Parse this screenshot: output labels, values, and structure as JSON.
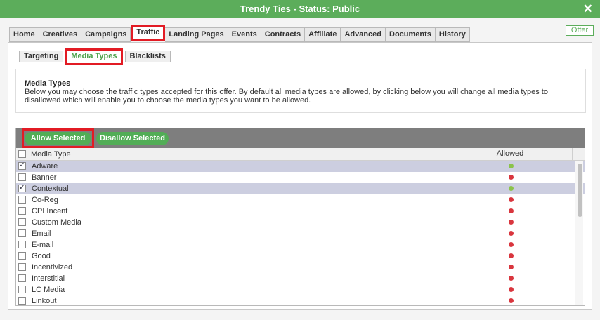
{
  "window": {
    "title": "Trendy Ties - Status: Public",
    "close_symbol": "✕",
    "title_bar_color": "#5cad5b"
  },
  "tabs": [
    {
      "label": "Home"
    },
    {
      "label": "Creatives"
    },
    {
      "label": "Campaigns"
    },
    {
      "label": "Traffic",
      "active": true
    },
    {
      "label": "Landing Pages"
    },
    {
      "label": "Events"
    },
    {
      "label": "Contracts"
    },
    {
      "label": "Affiliate"
    },
    {
      "label": "Advanced"
    },
    {
      "label": "Documents"
    },
    {
      "label": "History"
    }
  ],
  "badge": {
    "label": "Offer"
  },
  "subtabs": [
    {
      "label": "Targeting"
    },
    {
      "label": "Media Types",
      "active": true
    },
    {
      "label": "Blacklists"
    }
  ],
  "info": {
    "heading": "Media Types",
    "text": "Below you may choose the traffic types accepted for this offer. By default all media types are allowed, by clicking below you will change all media types to disallowed which will enable you to choose the media types you want to be allowed."
  },
  "toolbar": {
    "allow_label": "Allow Selected",
    "disallow_label": "Disallow Selected"
  },
  "table": {
    "columns": {
      "name": "Media Type",
      "allowed": "Allowed"
    },
    "rows": [
      {
        "name": "Adware",
        "checked": true,
        "allowed": true
      },
      {
        "name": "Banner",
        "checked": false,
        "allowed": false
      },
      {
        "name": "Contextual",
        "checked": true,
        "allowed": true
      },
      {
        "name": "Co-Reg",
        "checked": false,
        "allowed": false
      },
      {
        "name": "CPI Incent",
        "checked": false,
        "allowed": false
      },
      {
        "name": "Custom Media",
        "checked": false,
        "allowed": false
      },
      {
        "name": "Email",
        "checked": false,
        "allowed": false
      },
      {
        "name": "E-mail",
        "checked": false,
        "allowed": false
      },
      {
        "name": "Good",
        "checked": false,
        "allowed": false
      },
      {
        "name": "Incentivized",
        "checked": false,
        "allowed": false
      },
      {
        "name": "Interstitial",
        "checked": false,
        "allowed": false
      },
      {
        "name": "LC Media",
        "checked": false,
        "allowed": false
      },
      {
        "name": "Linkout",
        "checked": false,
        "allowed": false
      }
    ]
  },
  "colors": {
    "accent_green": "#5cad5b",
    "highlight_red": "#e21b24",
    "allowed_dot": "#8bc34a",
    "disallowed_dot": "#d9363e"
  }
}
